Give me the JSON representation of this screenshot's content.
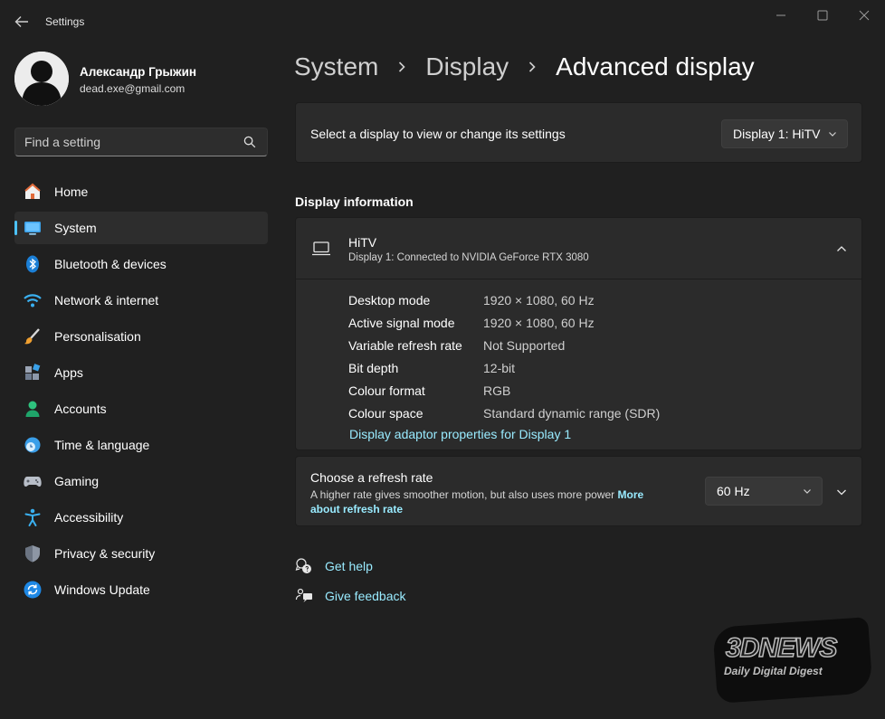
{
  "app": {
    "title": "Settings"
  },
  "user": {
    "name": "Александр Грыжин",
    "email": "dead.exe@gmail.com"
  },
  "search": {
    "placeholder": "Find a setting"
  },
  "sidebar": {
    "items": [
      {
        "label": "Home",
        "icon": "home-icon",
        "active": false
      },
      {
        "label": "System",
        "icon": "system-icon",
        "active": true
      },
      {
        "label": "Bluetooth & devices",
        "icon": "bluetooth-icon",
        "active": false
      },
      {
        "label": "Network & internet",
        "icon": "wifi-icon",
        "active": false
      },
      {
        "label": "Personalisation",
        "icon": "brush-icon",
        "active": false
      },
      {
        "label": "Apps",
        "icon": "apps-icon",
        "active": false
      },
      {
        "label": "Accounts",
        "icon": "person-icon",
        "active": false
      },
      {
        "label": "Time & language",
        "icon": "clock-globe-icon",
        "active": false
      },
      {
        "label": "Gaming",
        "icon": "gamepad-icon",
        "active": false
      },
      {
        "label": "Accessibility",
        "icon": "accessibility-icon",
        "active": false
      },
      {
        "label": "Privacy & security",
        "icon": "shield-icon",
        "active": false
      },
      {
        "label": "Windows Update",
        "icon": "update-icon",
        "active": false
      }
    ]
  },
  "breadcrumb": {
    "items": [
      "System",
      "Display",
      "Advanced display"
    ]
  },
  "display_select": {
    "label": "Select a display to view or change its settings",
    "value": "Display 1: HiTV"
  },
  "display_info": {
    "section_title": "Display information",
    "name": "HiTV",
    "subtitle": "Display 1: Connected to NVIDIA GeForce RTX 3080",
    "rows": [
      {
        "key": "Desktop mode",
        "value": "1920 × 1080, 60 Hz"
      },
      {
        "key": "Active signal mode",
        "value": "1920 × 1080, 60 Hz"
      },
      {
        "key": "Variable refresh rate",
        "value": "Not Supported"
      },
      {
        "key": "Bit depth",
        "value": "12-bit"
      },
      {
        "key": "Colour format",
        "value": "RGB"
      },
      {
        "key": "Colour space",
        "value": "Standard dynamic range (SDR)"
      }
    ],
    "adapter_link": "Display adaptor properties for Display 1"
  },
  "refresh_rate": {
    "title": "Choose a refresh rate",
    "description": "A higher rate gives smoother motion, but also uses more power",
    "more_link": "More about refresh rate",
    "value": "60 Hz"
  },
  "help": {
    "get_help": "Get help",
    "give_feedback": "Give feedback"
  },
  "watermark": {
    "big": "3DNEWS",
    "small": "Daily Digital Digest"
  },
  "colors": {
    "accent": "#4cc2ff",
    "link": "#99ebff",
    "background": "#202020",
    "card": "#2b2b2b"
  }
}
